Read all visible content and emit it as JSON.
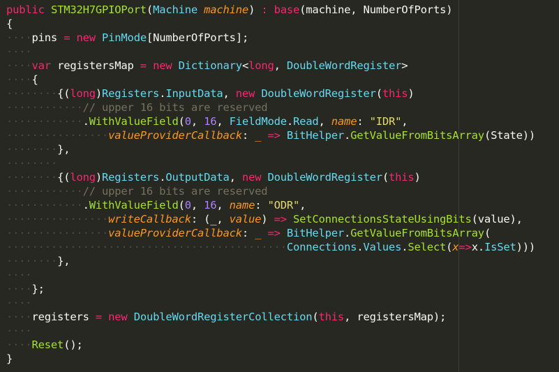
{
  "theme": {
    "background": "#272822",
    "default": "#f8f8f2",
    "keyword": "#f92672",
    "type": "#66d9ef",
    "method": "#a6e22e",
    "number": "#ae81ff",
    "string": "#e6db74",
    "param": "#fd971f",
    "comment": "#75715e",
    "whitespace": "#4a4b44"
  },
  "lines": [
    {
      "indent": 0,
      "tokens": [
        {
          "t": "public",
          "c": "keyword"
        },
        {
          "t": " ",
          "c": "default"
        },
        {
          "t": "STM32H7GPIOPort",
          "c": "method"
        },
        {
          "t": "(",
          "c": "default"
        },
        {
          "t": "Machine",
          "c": "type"
        },
        {
          "t": " ",
          "c": "default"
        },
        {
          "t": "machine",
          "c": "param",
          "i": true
        },
        {
          "t": ")",
          "c": "default"
        },
        {
          "t": " ",
          "c": "default"
        },
        {
          "t": ":",
          "c": "keyword"
        },
        {
          "t": " ",
          "c": "default"
        },
        {
          "t": "base",
          "c": "keyword"
        },
        {
          "t": "(machine, NumberOfPorts)",
          "c": "default"
        }
      ]
    },
    {
      "indent": 0,
      "tokens": [
        {
          "t": "{",
          "c": "default"
        }
      ]
    },
    {
      "indent": 1,
      "tokens": [
        {
          "t": "pins",
          "c": "default"
        },
        {
          "t": " ",
          "c": "default"
        },
        {
          "t": "=",
          "c": "keyword"
        },
        {
          "t": " ",
          "c": "default"
        },
        {
          "t": "new",
          "c": "keyword"
        },
        {
          "t": " ",
          "c": "default"
        },
        {
          "t": "PinMode",
          "c": "type"
        },
        {
          "t": "[NumberOfPorts];",
          "c": "default"
        }
      ]
    },
    {
      "indent": 1,
      "empty": true,
      "tokens": []
    },
    {
      "indent": 1,
      "tokens": [
        {
          "t": "var",
          "c": "keyword"
        },
        {
          "t": " registersMap ",
          "c": "default"
        },
        {
          "t": "=",
          "c": "keyword"
        },
        {
          "t": " ",
          "c": "default"
        },
        {
          "t": "new",
          "c": "keyword"
        },
        {
          "t": " ",
          "c": "default"
        },
        {
          "t": "Dictionary",
          "c": "type"
        },
        {
          "t": "<",
          "c": "default"
        },
        {
          "t": "long",
          "c": "keyword"
        },
        {
          "t": ", ",
          "c": "default"
        },
        {
          "t": "DoubleWordRegister",
          "c": "type"
        },
        {
          "t": ">",
          "c": "default"
        }
      ]
    },
    {
      "indent": 1,
      "tokens": [
        {
          "t": "{",
          "c": "default"
        }
      ]
    },
    {
      "indent": 2,
      "tokens": [
        {
          "t": "{(",
          "c": "default"
        },
        {
          "t": "long",
          "c": "keyword"
        },
        {
          "t": ")",
          "c": "default"
        },
        {
          "t": "Registers",
          "c": "type"
        },
        {
          "t": ".",
          "c": "default"
        },
        {
          "t": "InputData",
          "c": "type"
        },
        {
          "t": ", ",
          "c": "default"
        },
        {
          "t": "new",
          "c": "keyword"
        },
        {
          "t": " ",
          "c": "default"
        },
        {
          "t": "DoubleWordRegister",
          "c": "type"
        },
        {
          "t": "(",
          "c": "default"
        },
        {
          "t": "this",
          "c": "keyword"
        },
        {
          "t": ")",
          "c": "default"
        }
      ]
    },
    {
      "indent": 3,
      "tokens": [
        {
          "t": "// upper 16 bits are reserved",
          "c": "comment"
        }
      ]
    },
    {
      "indent": 3,
      "tokens": [
        {
          "t": ".",
          "c": "default"
        },
        {
          "t": "WithValueField",
          "c": "method"
        },
        {
          "t": "(",
          "c": "default"
        },
        {
          "t": "0",
          "c": "number"
        },
        {
          "t": ", ",
          "c": "default"
        },
        {
          "t": "16",
          "c": "number"
        },
        {
          "t": ", ",
          "c": "default"
        },
        {
          "t": "FieldMode",
          "c": "type"
        },
        {
          "t": ".",
          "c": "default"
        },
        {
          "t": "Read",
          "c": "type"
        },
        {
          "t": ", ",
          "c": "default"
        },
        {
          "t": "name",
          "c": "param",
          "i": true
        },
        {
          "t": ": ",
          "c": "default"
        },
        {
          "t": "\"IDR\"",
          "c": "string"
        },
        {
          "t": ",",
          "c": "default"
        }
      ]
    },
    {
      "indent": 4,
      "tokens": [
        {
          "t": "valueProviderCallback",
          "c": "param",
          "i": true
        },
        {
          "t": ": ",
          "c": "default"
        },
        {
          "t": "_",
          "c": "param"
        },
        {
          "t": " ",
          "c": "default"
        },
        {
          "t": "=>",
          "c": "keyword"
        },
        {
          "t": " ",
          "c": "default"
        },
        {
          "t": "BitHelper",
          "c": "type"
        },
        {
          "t": ".",
          "c": "default"
        },
        {
          "t": "GetValueFromBitsArray",
          "c": "method"
        },
        {
          "t": "(State))",
          "c": "default"
        }
      ]
    },
    {
      "indent": 2,
      "tokens": [
        {
          "t": "},",
          "c": "default"
        }
      ]
    },
    {
      "indent": 2,
      "empty": true,
      "tokens": []
    },
    {
      "indent": 2,
      "tokens": [
        {
          "t": "{(",
          "c": "default"
        },
        {
          "t": "long",
          "c": "keyword"
        },
        {
          "t": ")",
          "c": "default"
        },
        {
          "t": "Registers",
          "c": "type"
        },
        {
          "t": ".",
          "c": "default"
        },
        {
          "t": "OutputData",
          "c": "type"
        },
        {
          "t": ", ",
          "c": "default"
        },
        {
          "t": "new",
          "c": "keyword"
        },
        {
          "t": " ",
          "c": "default"
        },
        {
          "t": "DoubleWordRegister",
          "c": "type"
        },
        {
          "t": "(",
          "c": "default"
        },
        {
          "t": "this",
          "c": "keyword"
        },
        {
          "t": ")",
          "c": "default"
        }
      ]
    },
    {
      "indent": 3,
      "tokens": [
        {
          "t": "// upper 16 bits are reserved",
          "c": "comment"
        }
      ]
    },
    {
      "indent": 3,
      "tokens": [
        {
          "t": ".",
          "c": "default"
        },
        {
          "t": "WithValueField",
          "c": "method"
        },
        {
          "t": "(",
          "c": "default"
        },
        {
          "t": "0",
          "c": "number"
        },
        {
          "t": ", ",
          "c": "default"
        },
        {
          "t": "16",
          "c": "number"
        },
        {
          "t": ", ",
          "c": "default"
        },
        {
          "t": "name",
          "c": "param",
          "i": true
        },
        {
          "t": ": ",
          "c": "default"
        },
        {
          "t": "\"ODR\"",
          "c": "string"
        },
        {
          "t": ",",
          "c": "default"
        }
      ]
    },
    {
      "indent": 4,
      "tokens": [
        {
          "t": "writeCallback",
          "c": "param",
          "i": true
        },
        {
          "t": ": (_, ",
          "c": "default"
        },
        {
          "t": "value",
          "c": "param",
          "i": true
        },
        {
          "t": ") ",
          "c": "default"
        },
        {
          "t": "=>",
          "c": "keyword"
        },
        {
          "t": " ",
          "c": "default"
        },
        {
          "t": "SetConnectionsStateUsingBits",
          "c": "method"
        },
        {
          "t": "(value),",
          "c": "default"
        }
      ]
    },
    {
      "indent": 4,
      "tokens": [
        {
          "t": "valueProviderCallback",
          "c": "param",
          "i": true
        },
        {
          "t": ": ",
          "c": "default"
        },
        {
          "t": "_",
          "c": "param"
        },
        {
          "t": " ",
          "c": "default"
        },
        {
          "t": "=>",
          "c": "keyword"
        },
        {
          "t": " ",
          "c": "default"
        },
        {
          "t": "BitHelper",
          "c": "type"
        },
        {
          "t": ".",
          "c": "default"
        },
        {
          "t": "GetValueFromBitsArray",
          "c": "method"
        },
        {
          "t": "(",
          "c": "default"
        }
      ]
    },
    {
      "indent": 11,
      "tokens": [
        {
          "t": "Connections",
          "c": "type"
        },
        {
          "t": ".",
          "c": "default"
        },
        {
          "t": "Values",
          "c": "type"
        },
        {
          "t": ".",
          "c": "default"
        },
        {
          "t": "Select",
          "c": "method"
        },
        {
          "t": "(",
          "c": "default"
        },
        {
          "t": "x",
          "c": "param",
          "i": true
        },
        {
          "t": "=>",
          "c": "keyword"
        },
        {
          "t": "x",
          "c": "default"
        },
        {
          "t": ".",
          "c": "default"
        },
        {
          "t": "IsSet",
          "c": "type"
        },
        {
          "t": ")))",
          "c": "default"
        }
      ]
    },
    {
      "indent": 2,
      "tokens": [
        {
          "t": "},",
          "c": "default"
        }
      ]
    },
    {
      "indent": 1,
      "empty": true,
      "tokens": []
    },
    {
      "indent": 1,
      "tokens": [
        {
          "t": "};",
          "c": "default"
        }
      ]
    },
    {
      "indent": 1,
      "empty": true,
      "tokens": []
    },
    {
      "indent": 1,
      "tokens": [
        {
          "t": "registers",
          "c": "default"
        },
        {
          "t": " ",
          "c": "default"
        },
        {
          "t": "=",
          "c": "keyword"
        },
        {
          "t": " ",
          "c": "default"
        },
        {
          "t": "new",
          "c": "keyword"
        },
        {
          "t": " ",
          "c": "default"
        },
        {
          "t": "DoubleWordRegisterCollection",
          "c": "type"
        },
        {
          "t": "(",
          "c": "default"
        },
        {
          "t": "this",
          "c": "keyword"
        },
        {
          "t": ", registersMap);",
          "c": "default"
        }
      ]
    },
    {
      "indent": 1,
      "empty": true,
      "tokens": []
    },
    {
      "indent": 1,
      "tokens": [
        {
          "t": "Reset",
          "c": "method"
        },
        {
          "t": "();",
          "c": "default"
        }
      ]
    },
    {
      "indent": 0,
      "tokens": [
        {
          "t": "}",
          "c": "default"
        }
      ]
    }
  ]
}
